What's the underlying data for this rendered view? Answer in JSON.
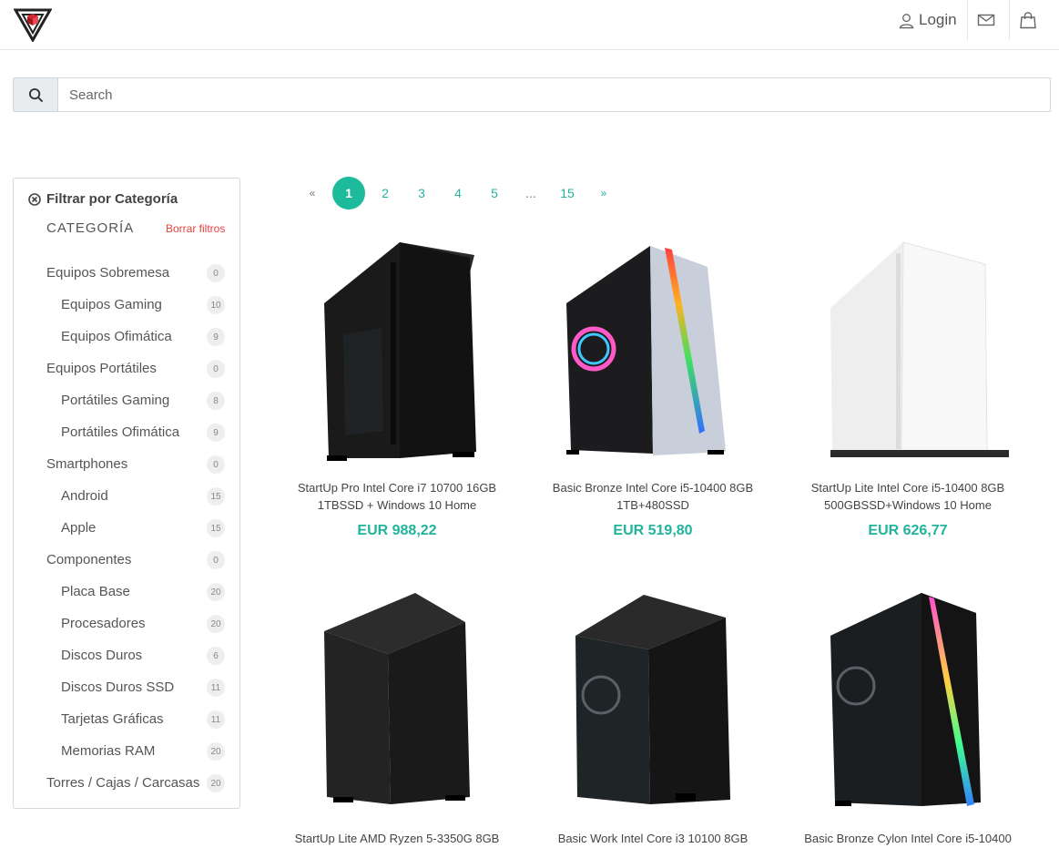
{
  "header": {
    "login_label": "Login",
    "icons": [
      "user-icon",
      "mail-icon",
      "shopping-bag-icon"
    ]
  },
  "search": {
    "placeholder": "Search"
  },
  "sidebar": {
    "title": "Filtrar por Categoría",
    "heading": "CATEGORÍA",
    "clear_label": "Borrar filtros",
    "categories": [
      {
        "label": "Equipos Sobremesa",
        "count": "0",
        "level": 0
      },
      {
        "label": "Equipos Gaming",
        "count": "10",
        "level": 1
      },
      {
        "label": "Equipos Ofimática",
        "count": "9",
        "level": 1
      },
      {
        "label": "Equipos Portátiles",
        "count": "0",
        "level": 0
      },
      {
        "label": "Portátiles Gaming",
        "count": "8",
        "level": 1
      },
      {
        "label": "Portátiles Ofimática",
        "count": "9",
        "level": 1
      },
      {
        "label": "Smartphones",
        "count": "0",
        "level": 0
      },
      {
        "label": "Android",
        "count": "15",
        "level": 1
      },
      {
        "label": "Apple",
        "count": "15",
        "level": 1
      },
      {
        "label": "Componentes",
        "count": "0",
        "level": 0
      },
      {
        "label": "Placa Base",
        "count": "20",
        "level": 1
      },
      {
        "label": "Procesadores",
        "count": "20",
        "level": 1
      },
      {
        "label": "Discos Duros",
        "count": "6",
        "level": 1
      },
      {
        "label": "Discos Duros SSD",
        "count": "11",
        "level": 1
      },
      {
        "label": "Tarjetas Gráficas",
        "count": "11",
        "level": 1
      },
      {
        "label": "Memorias RAM",
        "count": "20",
        "level": 1
      },
      {
        "label": "Torres / Cajas / Carcasas",
        "count": "20",
        "level": 0
      }
    ]
  },
  "pagination": {
    "first": "«",
    "pages": [
      "1",
      "2",
      "3",
      "4",
      "5"
    ],
    "ellipsis": "...",
    "last_page": "15",
    "next": "»",
    "current": "1"
  },
  "products": [
    {
      "name": "StartUp Pro Intel Core i7 10700 16GB 1TBSSD + Windows 10 Home",
      "price": "EUR 988,22"
    },
    {
      "name": "Basic Bronze Intel Core i5-10400 8GB 1TB+480SSD",
      "price": "EUR 519,80"
    },
    {
      "name": "StartUp Lite Intel Core i5-10400 8GB 500GBSSD+Windows 10 Home",
      "price": "EUR 626,77"
    },
    {
      "name": "StartUp Lite AMD Ryzen 5-3350G 8GB",
      "price": ""
    },
    {
      "name": "Basic Work Intel Core i3 10100 8GB",
      "price": ""
    },
    {
      "name": "Basic Bronze Cylon Intel Core i5-10400",
      "price": ""
    }
  ],
  "colors": {
    "accent": "#1dbb9b",
    "danger": "#e8413c"
  }
}
